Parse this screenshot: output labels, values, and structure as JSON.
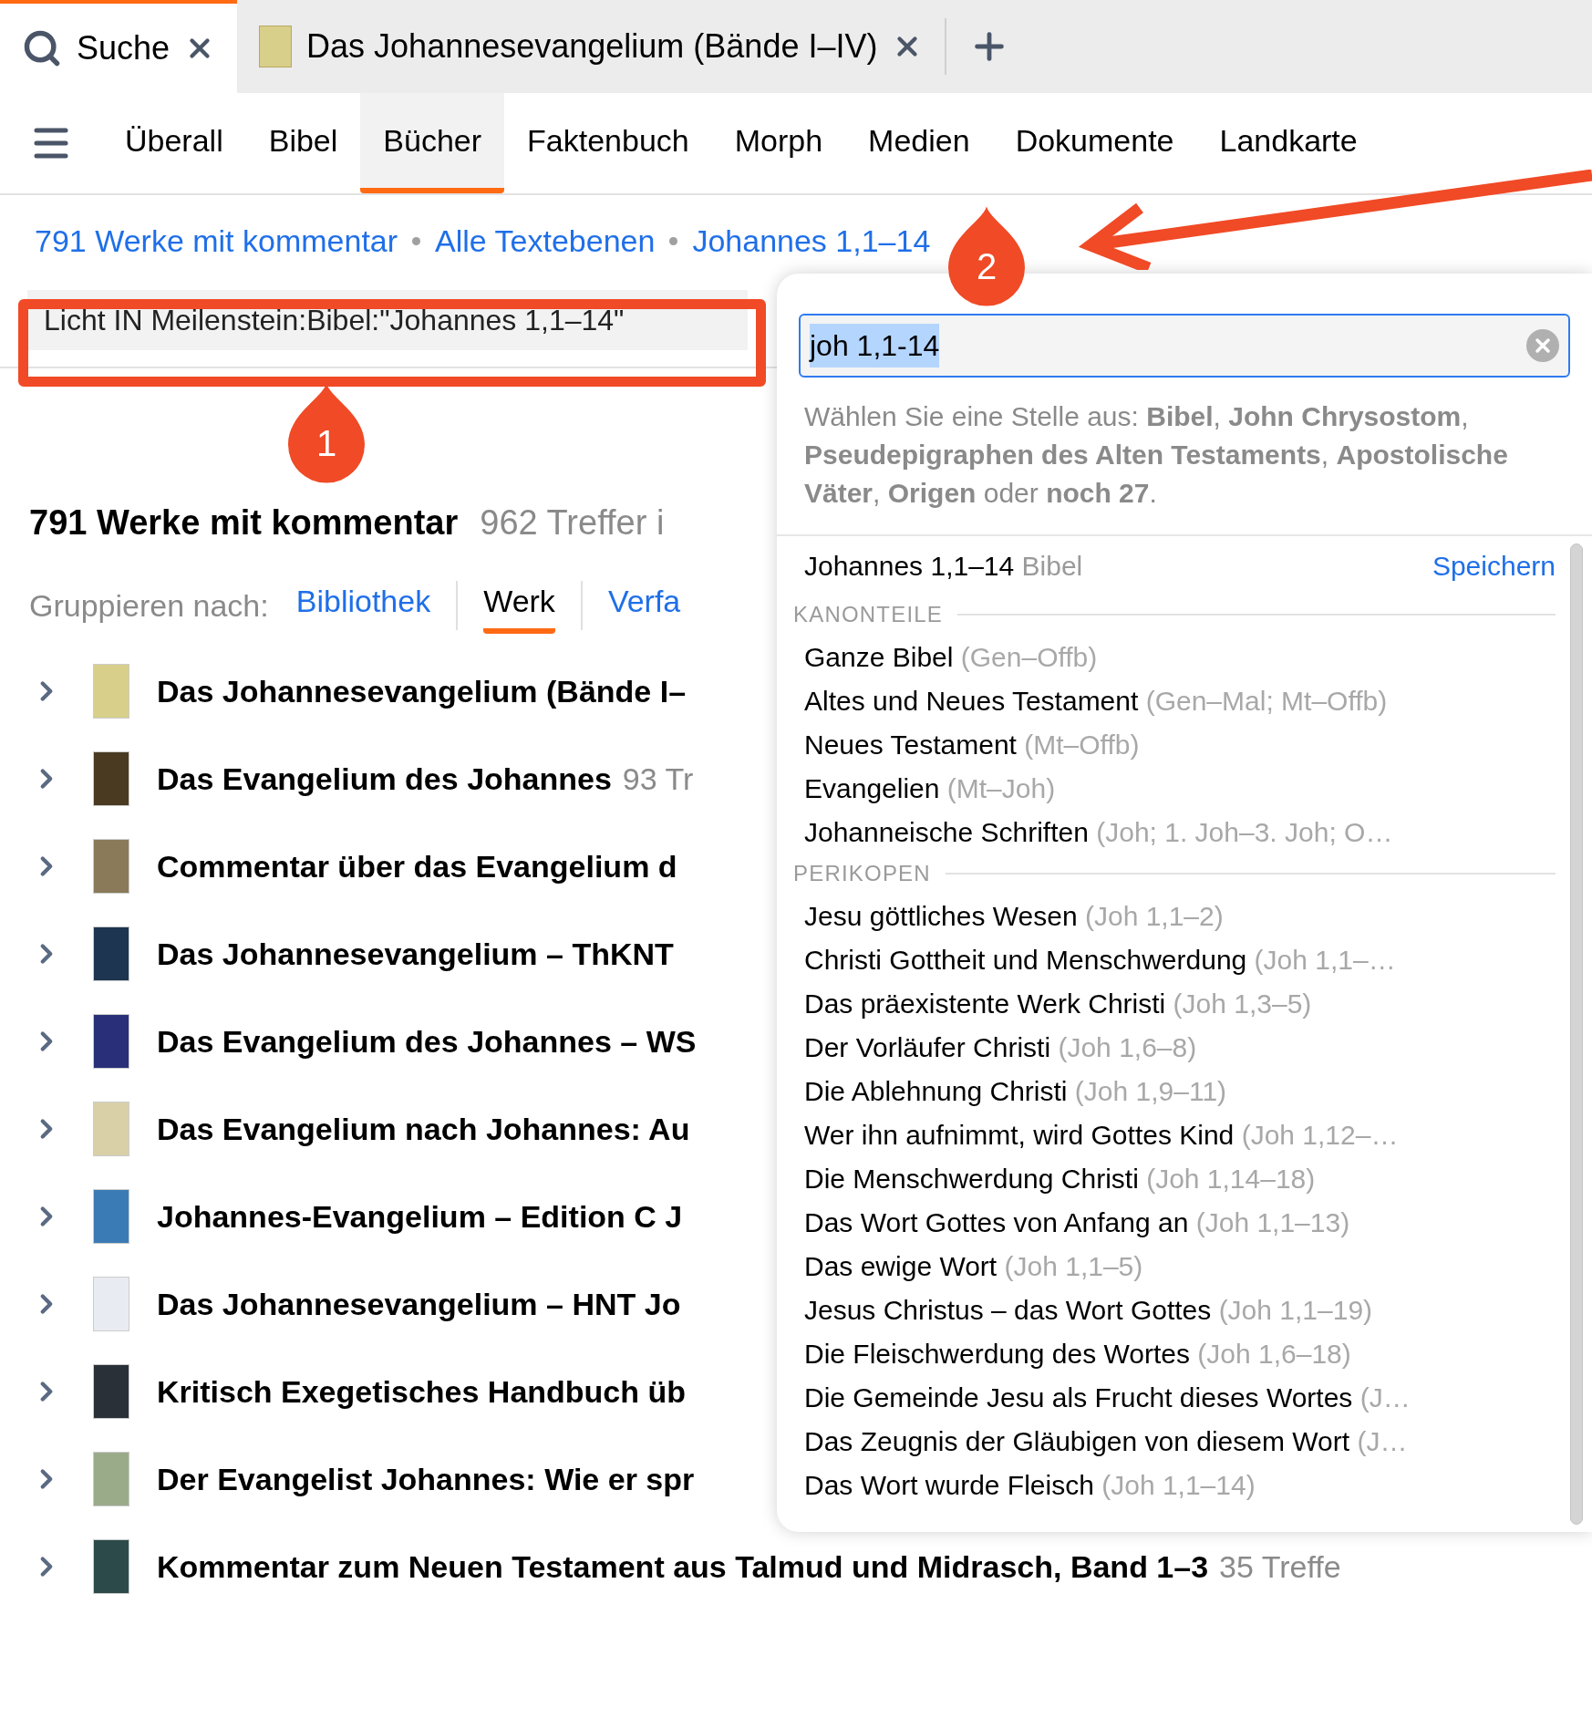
{
  "tabs": [
    {
      "label": "Suche",
      "kind": "search",
      "selected": true
    },
    {
      "label": "Das Johannesevangelium (Bände I–IV)",
      "kind": "book",
      "selected": false
    }
  ],
  "nav": [
    {
      "label": "Überall",
      "selected": false
    },
    {
      "label": "Bibel",
      "selected": false
    },
    {
      "label": "Bücher",
      "selected": true
    },
    {
      "label": "Faktenbuch",
      "selected": false
    },
    {
      "label": "Morph",
      "selected": false
    },
    {
      "label": "Medien",
      "selected": false
    },
    {
      "label": "Dokumente",
      "selected": false
    },
    {
      "label": "Landkarte",
      "selected": false
    }
  ],
  "breadcrumb": [
    "791 Werke mit kommentar",
    "Alle Textebenen",
    "Johannes 1,1–14"
  ],
  "query": "Licht IN Meilenstein:Bibel:\"Johannes 1,1–14\"",
  "heading": {
    "title": "791 Werke mit kommentar",
    "count": "962 Treffer i"
  },
  "group_by": {
    "label": "Gruppieren nach:",
    "options": [
      {
        "label": "Bibliothek",
        "selected": false
      },
      {
        "label": "Werk",
        "selected": true
      },
      {
        "label": "Verfa",
        "selected": false
      }
    ]
  },
  "results": [
    {
      "title": "Das Johannesevangelium (Bände I–"
    },
    {
      "title": "Das Evangelium des Johannes",
      "count": "93 Tr"
    },
    {
      "title": "Commentar über das Evangelium d"
    },
    {
      "title": "Das Johannesevangelium – ThKNT"
    },
    {
      "title": "Das Evangelium des Johannes – WS"
    },
    {
      "title": "Das Evangelium nach Johannes: Au"
    },
    {
      "title": "Johannes-Evangelium – Edition C J"
    },
    {
      "title": "Das Johannesevangelium – HNT Jo"
    },
    {
      "title": "Kritisch Exegetisches Handbuch üb"
    },
    {
      "title": "Der Evangelist Johannes: Wie er spr"
    },
    {
      "title": "Kommentar zum Neuen Testament aus Talmud und Midrasch, Band 1–3",
      "count": "35 Treffe"
    }
  ],
  "dropdown": {
    "input": {
      "value": "joh 1,1-14",
      "text_selected": true
    },
    "hint": "Wählen Sie eine Stelle aus: **Bibel**, **John Chrysostom**, **Pseudepigraphen des Alten Testaments**, **Apostolische Väter**, **Origen** oder **noch 27**.",
    "top": {
      "reference": "Johannes 1,1–14",
      "source": "Bibel",
      "action": "Speichern"
    },
    "sections": [
      {
        "heading": "KANONTEILE",
        "items": [
          {
            "name": "Ganze Bibel",
            "range": "(Gen–Offb)"
          },
          {
            "name": "Altes und Neues Testament",
            "range": "(Gen–Mal; Mt–Offb)"
          },
          {
            "name": "Neues Testament",
            "range": "(Mt–Offb)"
          },
          {
            "name": "Evangelien",
            "range": "(Mt–Joh)"
          },
          {
            "name": "Johanneische Schriften",
            "range": "(Joh; 1. Joh–3. Joh; O…"
          }
        ]
      },
      {
        "heading": "PERIKOPEN",
        "items": [
          {
            "name": "Jesu göttliches Wesen",
            "range": "(Joh 1,1–2)"
          },
          {
            "name": "Christi Gottheit und Menschwerdung",
            "range": "(Joh 1,1–…"
          },
          {
            "name": "Das präexistente Werk Christi",
            "range": "(Joh 1,3–5)"
          },
          {
            "name": "Der Vorläufer Christi",
            "range": "(Joh 1,6–8)"
          },
          {
            "name": "Die Ablehnung Christi",
            "range": "(Joh 1,9–11)"
          },
          {
            "name": "Wer ihn aufnimmt, wird Gottes Kind",
            "range": "(Joh 1,12–…"
          },
          {
            "name": "Die Menschwerdung Christi",
            "range": "(Joh 1,14–18)"
          },
          {
            "name": "Das Wort Gottes von Anfang an",
            "range": "(Joh 1,1–13)"
          },
          {
            "name": "Das ewige Wort",
            "range": "(Joh 1,1–5)"
          },
          {
            "name": "Jesus Christus – das Wort Gottes",
            "range": "(Joh 1,1–19)"
          },
          {
            "name": "Die Fleischwerdung des Wortes",
            "range": "(Joh 1,6–18)"
          },
          {
            "name": "Die Gemeinde Jesu als Frucht dieses Wortes",
            "range": "(J…"
          },
          {
            "name": "Das Zeugnis der Gläubigen von diesem Wort",
            "range": "(J…"
          },
          {
            "name": "Das Wort wurde Fleisch",
            "range": "(Joh 1,1–14)"
          }
        ]
      }
    ]
  },
  "markers": [
    "1",
    "2"
  ]
}
